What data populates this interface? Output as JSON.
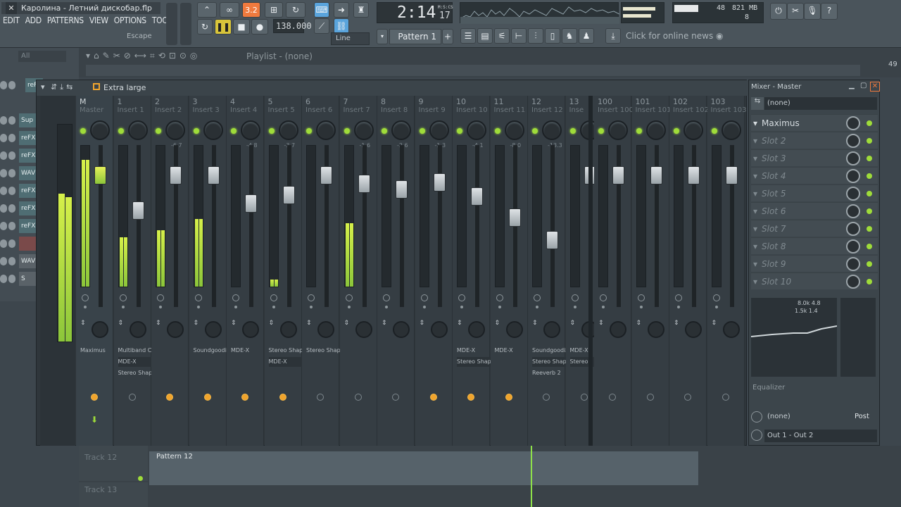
{
  "app": {
    "title": "Каролина - Летний дискобар.flp",
    "close_glyph": "✕"
  },
  "menu": [
    "EDIT",
    "ADD",
    "PATTERNS",
    "VIEW",
    "OPTIONS",
    "TOOLS",
    "?"
  ],
  "hint": {
    "escape": "Escape"
  },
  "transport": {
    "time": "2:14",
    "time_small": "17",
    "time_unit": "M:S:CS",
    "tempo": "138.000",
    "tempo_badge": "3.2",
    "pattern": "Pattern 1",
    "snap": "Line",
    "pattern_plus": "+"
  },
  "cpu": {
    "mem": "821 MB",
    "poly": "8",
    "cpu_val": "48"
  },
  "news": {
    "label": "Click for online news"
  },
  "browser": {
    "filter": "All"
  },
  "playlist": {
    "title": "Playlist - (none)",
    "end_marker": "49"
  },
  "channels": [
    "reFX",
    "Sup",
    "reFX",
    "WAV",
    "reFX",
    "reFX",
    "reFX",
    "",
    "WAVE",
    "S"
  ],
  "mixer": {
    "size_label": "Extra large",
    "title": "Mixer - Master",
    "strips": [
      {
        "num": "",
        "name": "M",
        "sub": "Master",
        "fx": [
          "Maximus"
        ]
      },
      {
        "num": "1",
        "name": "Insert 1",
        "db": "",
        "fx": [
          "Multiband Comp",
          "MDE-X",
          "Stereo Shaper"
        ]
      },
      {
        "num": "2",
        "name": "Insert 2",
        "db": "-6.7",
        "fx": []
      },
      {
        "num": "3",
        "name": "Insert 3",
        "db": "",
        "fx": [
          "Soundgoodizer"
        ]
      },
      {
        "num": "4",
        "name": "Insert 4",
        "db": "-4.8",
        "fx": [
          "MDE-X"
        ]
      },
      {
        "num": "5",
        "name": "Insert 5",
        "db": "-3.7",
        "fx": [
          "Stereo Shaper",
          "MDE-X"
        ]
      },
      {
        "num": "6",
        "name": "Insert 6",
        "db": "",
        "fx": [
          "Stereo Shaper"
        ]
      },
      {
        "num": "7",
        "name": "Insert 7",
        "db": "-1.6",
        "fx": []
      },
      {
        "num": "8",
        "name": "Insert 8",
        "db": "-2.6",
        "fx": []
      },
      {
        "num": "9",
        "name": "Insert 9",
        "db": "-1.3",
        "fx": []
      },
      {
        "num": "10",
        "name": "Insert 10",
        "db": "-4.1",
        "fx": [
          "MDE-X",
          "Stereo Shaper"
        ]
      },
      {
        "num": "11",
        "name": "Insert 11",
        "db": "-8.0",
        "fx": [
          "MDE-X"
        ]
      },
      {
        "num": "12",
        "name": "Insert 12",
        "db": "-13.3",
        "fx": [
          "Soundgoodizer",
          "Stereo Shaper",
          "Reeverb 2"
        ]
      },
      {
        "num": "13",
        "name": "Inse",
        "db": "",
        "fx": [
          "MDE-X",
          "Stereo"
        ]
      },
      {
        "num": "100",
        "name": "Insert 100",
        "db": "",
        "fx": []
      },
      {
        "num": "101",
        "name": "Insert 101",
        "db": "",
        "fx": []
      },
      {
        "num": "102",
        "name": "Insert 102",
        "db": "",
        "fx": []
      },
      {
        "num": "103",
        "name": "Insert 103",
        "db": "",
        "fx": []
      }
    ],
    "meter_scale": [
      "3",
      "3",
      "6"
    ]
  },
  "master_panel": {
    "preset": "(none)",
    "slots": [
      "Maximus",
      "Slot 2",
      "Slot 3",
      "Slot 4",
      "Slot 5",
      "Slot 6",
      "Slot 7",
      "Slot 8",
      "Slot 9",
      "Slot 10"
    ],
    "eq_label": "Equalizer",
    "eq_vals": "8.0k 4.8",
    "eq_vals2": "1.5k 1.4",
    "out_preset": "(none)",
    "post": "Post",
    "output": "Out 1 - Out 2"
  },
  "tracks": [
    {
      "name": "Track 12",
      "pattern": "Pattern 12"
    },
    {
      "name": "Track 13",
      "pattern": ""
    }
  ]
}
